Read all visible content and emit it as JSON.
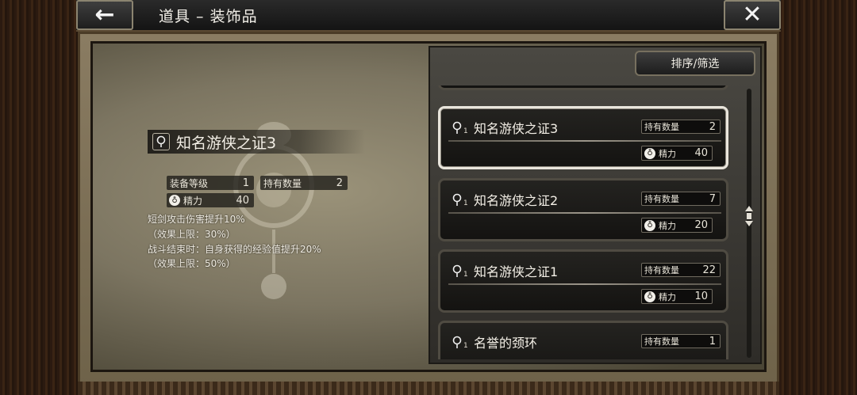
{
  "header": {
    "title": "道具 – 装饰品",
    "back_icon": "←",
    "close_icon": "✕"
  },
  "detail": {
    "name": "知名游侠之证3",
    "equip_level_label": "装备等级",
    "equip_level_value": "1",
    "owned_label": "持有数量",
    "owned_value": "2",
    "power_label": "精力",
    "power_value": "40",
    "description": [
      "短剑攻击伤害提升10%",
      "（效果上限：30%）",
      "战斗结束时：自身获得的经验值提升20%",
      "（效果上限：50%）"
    ]
  },
  "list": {
    "sort_label": "排序/筛选",
    "owned_label": "持有数量",
    "power_label": "精力",
    "items": [
      {
        "sub": "1",
        "name": "知名游侠之证3",
        "owned": "2",
        "power": "40",
        "selected": true
      },
      {
        "sub": "1",
        "name": "知名游侠之证2",
        "owned": "7",
        "power": "20",
        "selected": false
      },
      {
        "sub": "1",
        "name": "知名游侠之证1",
        "owned": "22",
        "power": "10",
        "selected": false
      },
      {
        "sub": "1",
        "name": "名誉的颈环",
        "owned": "1",
        "power": "",
        "selected": false
      }
    ]
  },
  "colors": {
    "accent_border": "#e9e5dc",
    "panel_bg": "#141311"
  }
}
